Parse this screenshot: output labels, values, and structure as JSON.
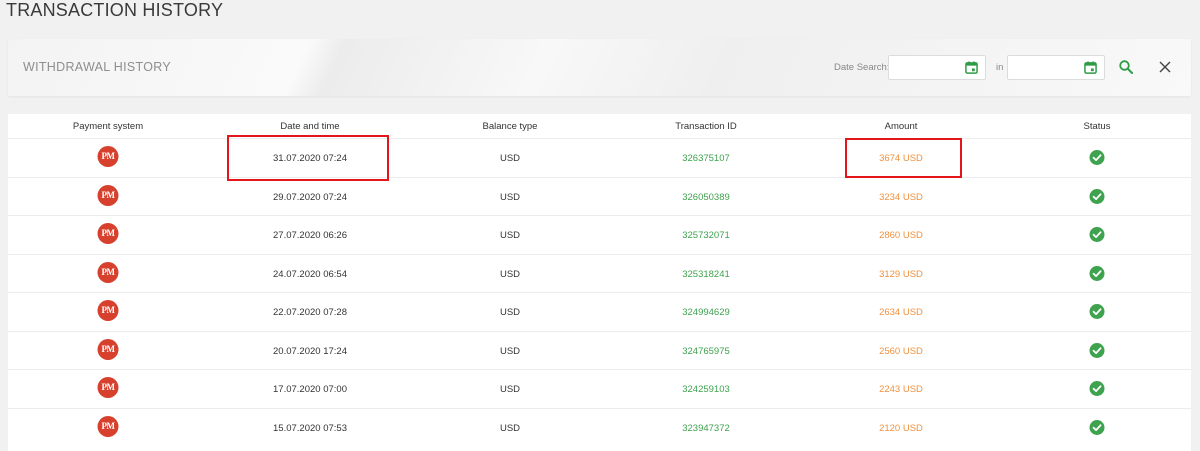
{
  "page_title": "TRANSACTION HISTORY",
  "filter": {
    "title": "WITHDRAWAL HISTORY",
    "date_search_label": "Date Search:",
    "in_label": "in",
    "from_value": "",
    "to_value": ""
  },
  "table": {
    "headers": [
      "Payment system",
      "Date and time",
      "Balance type",
      "Transaction ID",
      "Amount",
      "Status"
    ],
    "rows": [
      {
        "payment_system": "PM",
        "datetime": "31.07.2020 07:24",
        "balance_type": "USD",
        "transaction_id": "326375107",
        "amount": "3674 USD",
        "status": "completed"
      },
      {
        "payment_system": "PM",
        "datetime": "29.07.2020 07:24",
        "balance_type": "USD",
        "transaction_id": "326050389",
        "amount": "3234 USD",
        "status": "completed"
      },
      {
        "payment_system": "PM",
        "datetime": "27.07.2020 06:26",
        "balance_type": "USD",
        "transaction_id": "325732071",
        "amount": "2860 USD",
        "status": "completed"
      },
      {
        "payment_system": "PM",
        "datetime": "24.07.2020 06:54",
        "balance_type": "USD",
        "transaction_id": "325318241",
        "amount": "3129 USD",
        "status": "completed"
      },
      {
        "payment_system": "PM",
        "datetime": "22.07.2020 07:28",
        "balance_type": "USD",
        "transaction_id": "324994629",
        "amount": "2634 USD",
        "status": "completed"
      },
      {
        "payment_system": "PM",
        "datetime": "20.07.2020 17:24",
        "balance_type": "USD",
        "transaction_id": "324765975",
        "amount": "2560 USD",
        "status": "completed"
      },
      {
        "payment_system": "PM",
        "datetime": "17.07.2020 07:00",
        "balance_type": "USD",
        "transaction_id": "324259103",
        "amount": "2243 USD",
        "status": "completed"
      },
      {
        "payment_system": "PM",
        "datetime": "15.07.2020 07:53",
        "balance_type": "USD",
        "transaction_id": "323947372",
        "amount": "2120 USD",
        "status": "completed"
      }
    ]
  },
  "icons": {
    "calendar": "calendar-icon",
    "search": "search-icon",
    "close": "close-icon",
    "status": "check-circle-icon",
    "payment": "perfect-money-logo"
  },
  "colors": {
    "accent_green": "#3ea24f",
    "amount_orange": "#f0913d",
    "pm_red": "#d6402c",
    "highlight_red": "#e5161b"
  }
}
